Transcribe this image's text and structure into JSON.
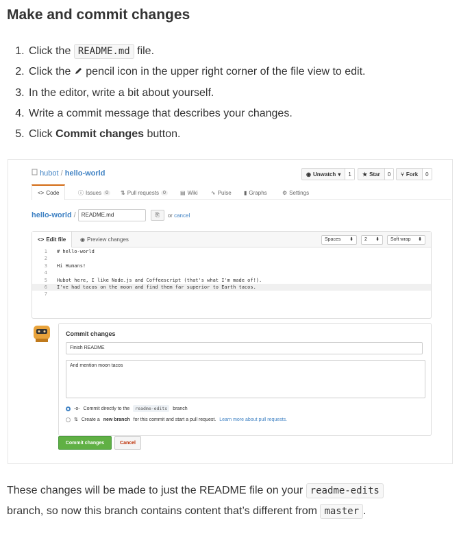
{
  "heading": "Make and commit changes",
  "steps": {
    "s1_pre": "Click the",
    "s1_code": "README.md",
    "s1_post": "file.",
    "s2_pre": "Click the",
    "s2_post": "pencil icon in the upper right corner of the file view to edit.",
    "s3": "In the editor, write a bit about yourself.",
    "s4": "Write a commit message that describes your changes.",
    "s5_pre": "Click",
    "s5_bold": "Commit changes",
    "s5_post": "button."
  },
  "screenshot": {
    "owner": "hubot",
    "sep": "/",
    "repo": "hello-world",
    "buttons": {
      "unwatch": "Unwatch",
      "unwatch_count": "1",
      "star": "Star",
      "star_count": "0",
      "fork": "Fork",
      "fork_count": "0"
    },
    "tabs": {
      "code": "Code",
      "issues": "Issues",
      "issues_count": "0",
      "pulls": "Pull requests",
      "pulls_count": "0",
      "wiki": "Wiki",
      "pulse": "Pulse",
      "graphs": "Graphs",
      "settings": "Settings"
    },
    "path": {
      "repo": "hello-world",
      "slash": "/",
      "filename": "README.md",
      "or": "or",
      "cancel": "cancel"
    },
    "editor": {
      "tab_edit": "Edit file",
      "tab_preview": "Preview changes",
      "indent_mode": "Spaces",
      "indent_size": "2",
      "wrap_mode": "Soft wrap",
      "lines": [
        {
          "n": "1",
          "text": "# hello-world"
        },
        {
          "n": "2",
          "text": ""
        },
        {
          "n": "3",
          "text": "Hi Humans!"
        },
        {
          "n": "4",
          "text": ""
        },
        {
          "n": "5",
          "text": "Hubot here, I like Node.js and Coffeescript (that's what I'm made of!)."
        },
        {
          "n": "6",
          "text": "I've had tacos on the moon and find them far superior to Earth tacos."
        },
        {
          "n": "7",
          "text": ""
        }
      ]
    },
    "commit": {
      "title": "Commit changes",
      "message": "Finish README",
      "description": "And mention moon tacos",
      "opt1_pre": "Commit directly to the",
      "opt1_branch": "readme-edits",
      "opt1_post": "branch",
      "opt2_pre": "Create a",
      "opt2_bold": "new branch",
      "opt2_mid": "for this commit and start a pull request.",
      "opt2_link": "Learn more about pull requests.",
      "commit_btn": "Commit changes",
      "cancel_btn": "Cancel"
    }
  },
  "footer": {
    "p1": "These changes will be made to just the README file on your",
    "code1": "readme-edits",
    "p2": "branch, so now this branch contains content that’s different from",
    "code2": "master",
    "p3": "."
  }
}
